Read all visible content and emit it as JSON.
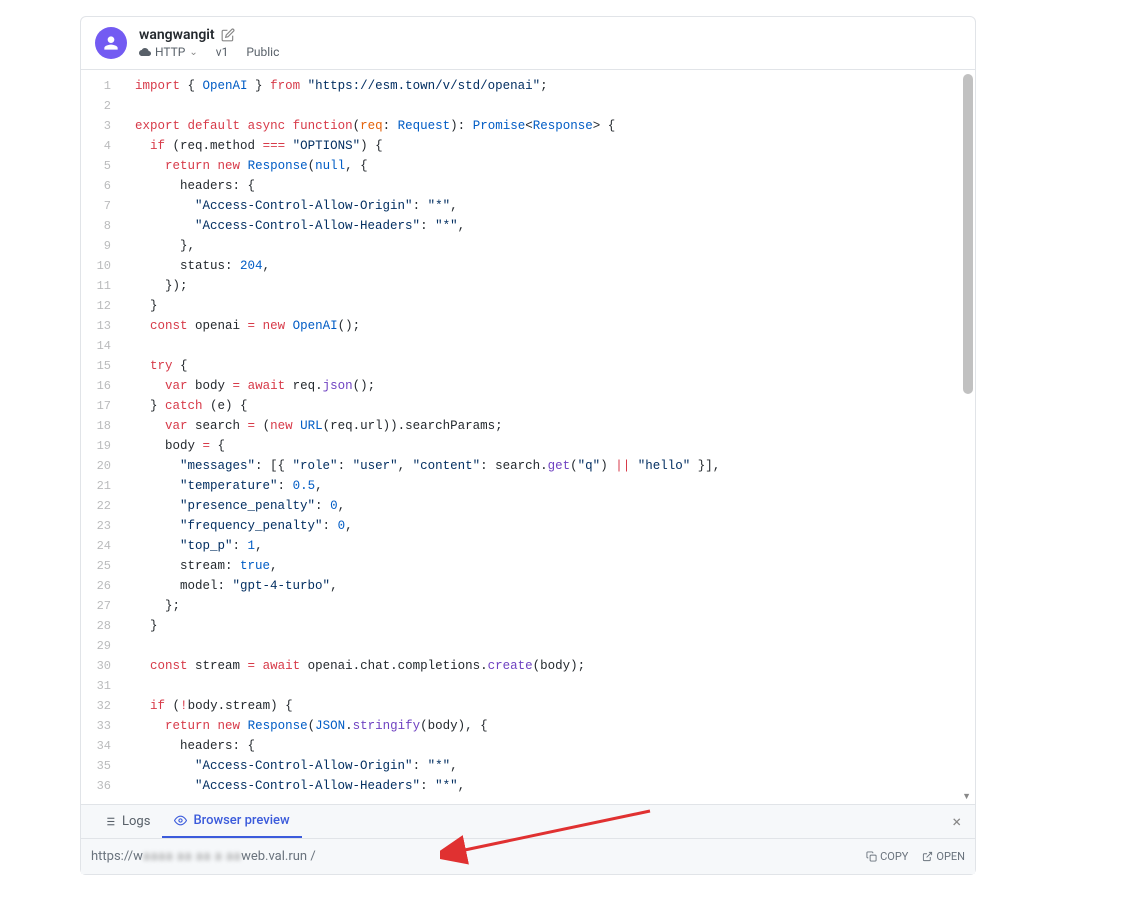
{
  "header": {
    "username": "wangwangit",
    "type_label": "HTTP",
    "version": "v1",
    "visibility": "Public"
  },
  "code_lines": [
    [
      [
        "k-red",
        "import"
      ],
      [
        "",
        " { "
      ],
      [
        "k-blue",
        "OpenAI"
      ],
      [
        "",
        " } "
      ],
      [
        "k-red",
        "from"
      ],
      [
        "",
        " "
      ],
      [
        "k-navy",
        "\"https://esm.town/v/std/openai\""
      ],
      [
        "",
        ";"
      ]
    ],
    [],
    [
      [
        "k-red",
        "export"
      ],
      [
        "",
        " "
      ],
      [
        "k-red",
        "default"
      ],
      [
        "",
        " "
      ],
      [
        "k-red",
        "async"
      ],
      [
        "",
        " "
      ],
      [
        "k-red",
        "function"
      ],
      [
        "",
        "("
      ],
      [
        "k-orange",
        "req"
      ],
      [
        "",
        ": "
      ],
      [
        "k-blue",
        "Request"
      ],
      [
        "",
        "): "
      ],
      [
        "k-blue",
        "Promise"
      ],
      [
        "",
        "<"
      ],
      [
        "k-blue",
        "Response"
      ],
      [
        "",
        "> {"
      ]
    ],
    [
      [
        "",
        "  "
      ],
      [
        "k-red",
        "if"
      ],
      [
        "",
        " (req.method "
      ],
      [
        "k-red",
        "==="
      ],
      [
        "",
        " "
      ],
      [
        "k-navy",
        "\"OPTIONS\""
      ],
      [
        "",
        ") {"
      ]
    ],
    [
      [
        "",
        "    "
      ],
      [
        "k-red",
        "return"
      ],
      [
        "",
        " "
      ],
      [
        "k-red",
        "new"
      ],
      [
        "",
        " "
      ],
      [
        "k-blue",
        "Response"
      ],
      [
        "",
        "("
      ],
      [
        "k-blue",
        "null"
      ],
      [
        "",
        ", {"
      ]
    ],
    [
      [
        "",
        "      headers: {"
      ]
    ],
    [
      [
        "",
        "        "
      ],
      [
        "k-navy",
        "\"Access-Control-Allow-Origin\""
      ],
      [
        "",
        ": "
      ],
      [
        "k-navy",
        "\"*\""
      ],
      [
        "",
        ","
      ]
    ],
    [
      [
        "",
        "        "
      ],
      [
        "k-navy",
        "\"Access-Control-Allow-Headers\""
      ],
      [
        "",
        ": "
      ],
      [
        "k-navy",
        "\"*\""
      ],
      [
        "",
        ","
      ]
    ],
    [
      [
        "",
        "      },"
      ]
    ],
    [
      [
        "",
        "      status: "
      ],
      [
        "k-blue",
        "204"
      ],
      [
        "",
        ","
      ]
    ],
    [
      [
        "",
        "    });"
      ]
    ],
    [
      [
        "",
        "  }"
      ]
    ],
    [
      [
        "",
        "  "
      ],
      [
        "k-red",
        "const"
      ],
      [
        "",
        " openai "
      ],
      [
        "k-red",
        "="
      ],
      [
        "",
        " "
      ],
      [
        "k-red",
        "new"
      ],
      [
        "",
        " "
      ],
      [
        "k-blue",
        "OpenAI"
      ],
      [
        "",
        "();"
      ]
    ],
    [],
    [
      [
        "",
        "  "
      ],
      [
        "k-red",
        "try"
      ],
      [
        "",
        " {"
      ]
    ],
    [
      [
        "",
        "    "
      ],
      [
        "k-red",
        "var"
      ],
      [
        "",
        " body "
      ],
      [
        "k-red",
        "="
      ],
      [
        "",
        " "
      ],
      [
        "k-red",
        "await"
      ],
      [
        "",
        " req."
      ],
      [
        "k-purple",
        "json"
      ],
      [
        "",
        "();"
      ]
    ],
    [
      [
        "",
        "  } "
      ],
      [
        "k-red",
        "catch"
      ],
      [
        "",
        " (e) {"
      ]
    ],
    [
      [
        "",
        "    "
      ],
      [
        "k-red",
        "var"
      ],
      [
        "",
        " search "
      ],
      [
        "k-red",
        "="
      ],
      [
        "",
        " ("
      ],
      [
        "k-red",
        "new"
      ],
      [
        "",
        " "
      ],
      [
        "k-blue",
        "URL"
      ],
      [
        "",
        "(req.url)).searchParams;"
      ]
    ],
    [
      [
        "",
        "    body "
      ],
      [
        "k-red",
        "="
      ],
      [
        "",
        " {"
      ]
    ],
    [
      [
        "",
        "      "
      ],
      [
        "k-navy",
        "\"messages\""
      ],
      [
        "",
        ": [{ "
      ],
      [
        "k-navy",
        "\"role\""
      ],
      [
        "",
        ": "
      ],
      [
        "k-navy",
        "\"user\""
      ],
      [
        "",
        ", "
      ],
      [
        "k-navy",
        "\"content\""
      ],
      [
        "",
        ": search."
      ],
      [
        "k-purple",
        "get"
      ],
      [
        "",
        "("
      ],
      [
        "k-navy",
        "\"q\""
      ],
      [
        "",
        ") "
      ],
      [
        "k-red",
        "||"
      ],
      [
        "",
        " "
      ],
      [
        "k-navy",
        "\"hello\""
      ],
      [
        "",
        " }],"
      ]
    ],
    [
      [
        "",
        "      "
      ],
      [
        "k-navy",
        "\"temperature\""
      ],
      [
        "",
        ": "
      ],
      [
        "k-blue",
        "0.5"
      ],
      [
        "",
        ","
      ]
    ],
    [
      [
        "",
        "      "
      ],
      [
        "k-navy",
        "\"presence_penalty\""
      ],
      [
        "",
        ": "
      ],
      [
        "k-blue",
        "0"
      ],
      [
        "",
        ","
      ]
    ],
    [
      [
        "",
        "      "
      ],
      [
        "k-navy",
        "\"frequency_penalty\""
      ],
      [
        "",
        ": "
      ],
      [
        "k-blue",
        "0"
      ],
      [
        "",
        ","
      ]
    ],
    [
      [
        "",
        "      "
      ],
      [
        "k-navy",
        "\"top_p\""
      ],
      [
        "",
        ": "
      ],
      [
        "k-blue",
        "1"
      ],
      [
        "",
        ","
      ]
    ],
    [
      [
        "",
        "      stream: "
      ],
      [
        "k-blue",
        "true"
      ],
      [
        "",
        ","
      ]
    ],
    [
      [
        "",
        "      model: "
      ],
      [
        "k-navy",
        "\"gpt-4-turbo\""
      ],
      [
        "",
        ","
      ]
    ],
    [
      [
        "",
        "    };"
      ]
    ],
    [
      [
        "",
        "  }"
      ]
    ],
    [],
    [
      [
        "",
        "  "
      ],
      [
        "k-red",
        "const"
      ],
      [
        "",
        " stream "
      ],
      [
        "k-red",
        "="
      ],
      [
        "",
        " "
      ],
      [
        "k-red",
        "await"
      ],
      [
        "",
        " openai.chat.completions."
      ],
      [
        "k-purple",
        "create"
      ],
      [
        "",
        "(body);"
      ]
    ],
    [],
    [
      [
        "",
        "  "
      ],
      [
        "k-red",
        "if"
      ],
      [
        "",
        " ("
      ],
      [
        "k-red",
        "!"
      ],
      [
        "",
        "body.stream) {"
      ]
    ],
    [
      [
        "",
        "    "
      ],
      [
        "k-red",
        "return"
      ],
      [
        "",
        " "
      ],
      [
        "k-red",
        "new"
      ],
      [
        "",
        " "
      ],
      [
        "k-blue",
        "Response"
      ],
      [
        "",
        "("
      ],
      [
        "k-blue",
        "JSON"
      ],
      [
        "",
        "."
      ],
      [
        "k-purple",
        "stringify"
      ],
      [
        "",
        "(body), {"
      ]
    ],
    [
      [
        "",
        "      headers: {"
      ]
    ],
    [
      [
        "",
        "        "
      ],
      [
        "k-navy",
        "\"Access-Control-Allow-Origin\""
      ],
      [
        "",
        ": "
      ],
      [
        "k-navy",
        "\"*\""
      ],
      [
        "",
        ","
      ]
    ],
    [
      [
        "",
        "        "
      ],
      [
        "k-navy",
        "\"Access-Control-Allow-Headers\""
      ],
      [
        "",
        ": "
      ],
      [
        "k-navy",
        "\"*\""
      ],
      [
        "",
        ","
      ]
    ]
  ],
  "tabs": {
    "logs": "Logs",
    "browser_preview": "Browser preview"
  },
  "url_bar": {
    "prefix": "https://w",
    "blurred": "aaaa  aa aa  a  aa",
    "suffix": "web.val.run /",
    "copy": "COPY",
    "open": "OPEN"
  }
}
